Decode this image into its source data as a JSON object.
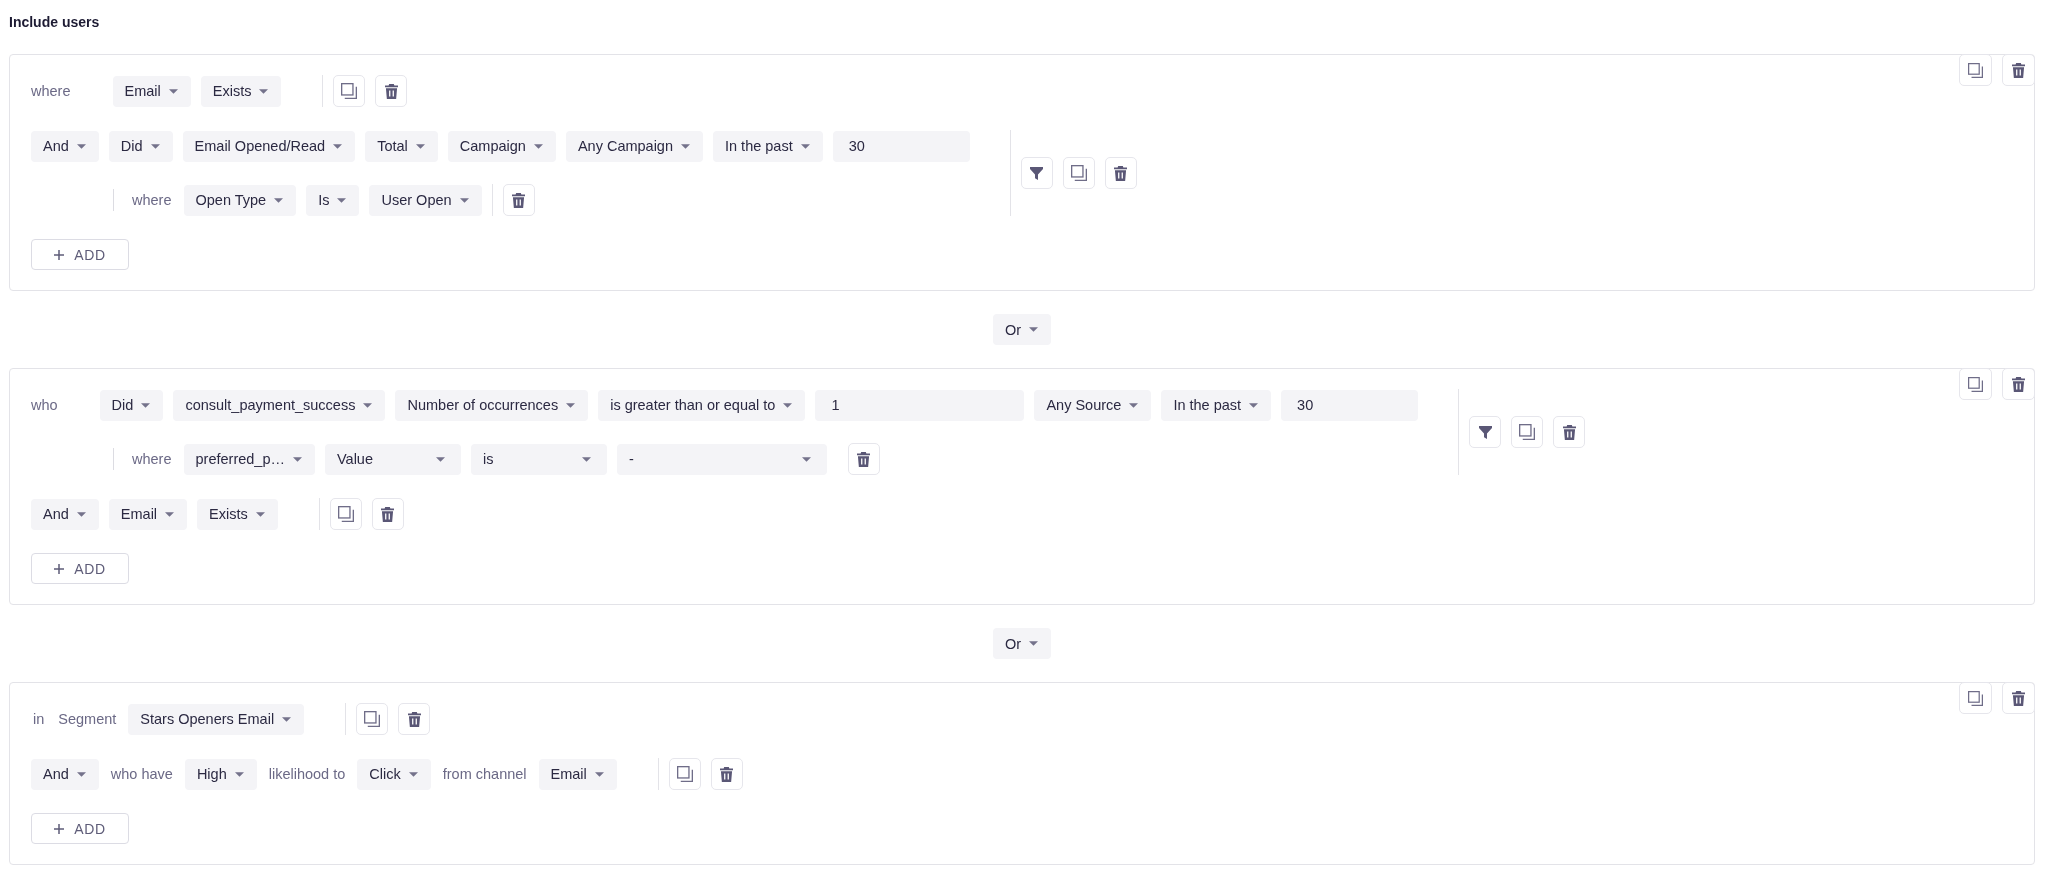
{
  "title": "Include users",
  "blocks": [
    {
      "kind": "group",
      "rows": [
        {
          "kind": "property",
          "items": [
            {
              "kind": "lead",
              "text": "where"
            },
            {
              "kind": "dropdown",
              "text": "Email"
            },
            {
              "kind": "dropdown",
              "text": "Exists"
            }
          ]
        },
        {
          "kind": "event",
          "items": [
            {
              "kind": "dropdown",
              "text": "And"
            },
            {
              "kind": "dropdown",
              "text": "Did"
            },
            {
              "kind": "dropdown",
              "text": "Email Opened/Read"
            },
            {
              "kind": "dropdown",
              "text": "Total"
            },
            {
              "kind": "dropdown",
              "text": "Campaign"
            },
            {
              "kind": "dropdown",
              "text": "Any Campaign"
            },
            {
              "kind": "dropdown",
              "text": "In the past"
            },
            {
              "kind": "input",
              "value": "30"
            }
          ],
          "filters": [
            {
              "divider": true,
              "items": [
                {
                  "kind": "label",
                  "text": "where"
                },
                {
                  "kind": "dropdown",
                  "text": "Open Type"
                },
                {
                  "kind": "dropdown",
                  "text": "Is"
                },
                {
                  "kind": "dropdown",
                  "text": "User Open"
                }
              ]
            }
          ]
        }
      ],
      "add_button": "ADD"
    },
    {
      "kind": "joiner",
      "text": "Or"
    },
    {
      "kind": "group",
      "rows": [
        {
          "kind": "event",
          "items": [
            {
              "kind": "lead",
              "text": "who"
            },
            {
              "kind": "dropdown",
              "text": "Did"
            },
            {
              "kind": "dropdown",
              "text": "consult_payment_success"
            },
            {
              "kind": "dropdown",
              "text": "Number of occurrences"
            },
            {
              "kind": "dropdown",
              "text": "is greater than or equal to"
            },
            {
              "kind": "input",
              "value": "1"
            },
            {
              "kind": "dropdown",
              "text": "Any Source"
            },
            {
              "kind": "dropdown",
              "text": "In the past"
            },
            {
              "kind": "input",
              "value": "30"
            }
          ],
          "filters": [
            {
              "divider": false,
              "items": [
                {
                  "kind": "label",
                  "text": "where"
                },
                {
                  "kind": "dropdown",
                  "text": "preferred_p…"
                },
                {
                  "kind": "select",
                  "text": "Value"
                },
                {
                  "kind": "select",
                  "text": "is"
                },
                {
                  "kind": "select",
                  "text": "-"
                }
              ]
            }
          ]
        },
        {
          "kind": "property",
          "items": [
            {
              "kind": "dropdown",
              "text": "And"
            },
            {
              "kind": "dropdown",
              "text": "Email"
            },
            {
              "kind": "dropdown",
              "text": "Exists"
            }
          ]
        }
      ],
      "add_button": "ADD"
    },
    {
      "kind": "joiner",
      "text": "Or"
    },
    {
      "kind": "group",
      "rows": [
        {
          "kind": "property",
          "items": [
            {
              "kind": "label",
              "text": "in"
            },
            {
              "kind": "label",
              "text": "Segment"
            },
            {
              "kind": "dropdown",
              "text": "Stars Openers Email"
            }
          ]
        },
        {
          "kind": "property",
          "items": [
            {
              "kind": "dropdown",
              "text": "And"
            },
            {
              "kind": "label",
              "text": "who have"
            },
            {
              "kind": "dropdown",
              "text": "High"
            },
            {
              "kind": "label",
              "text": "likelihood to"
            },
            {
              "kind": "dropdown",
              "text": "Click"
            },
            {
              "kind": "label",
              "text": "from channel"
            },
            {
              "kind": "dropdown",
              "text": "Email"
            }
          ]
        }
      ],
      "add_button": "ADD"
    }
  ]
}
